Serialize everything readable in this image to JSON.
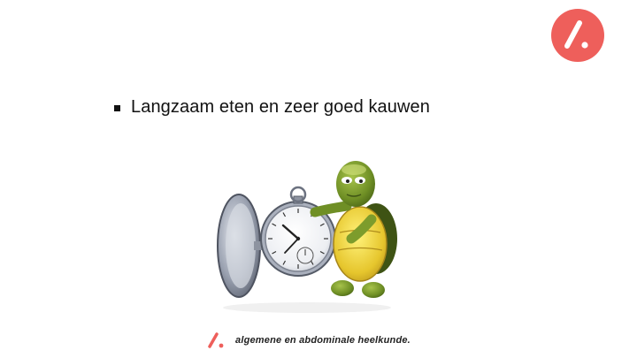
{
  "slide": {
    "bullet_text": "Langzaam eten en zeer goed kauwen"
  },
  "footer": {
    "org_text": "algemene en abdominale heelkunde."
  },
  "brand": {
    "accent_color": "#EE5F5B",
    "logo_icon": "slash-dot-logo-icon"
  },
  "illustration": {
    "icon": "turtle-with-pocket-watch-icon"
  }
}
